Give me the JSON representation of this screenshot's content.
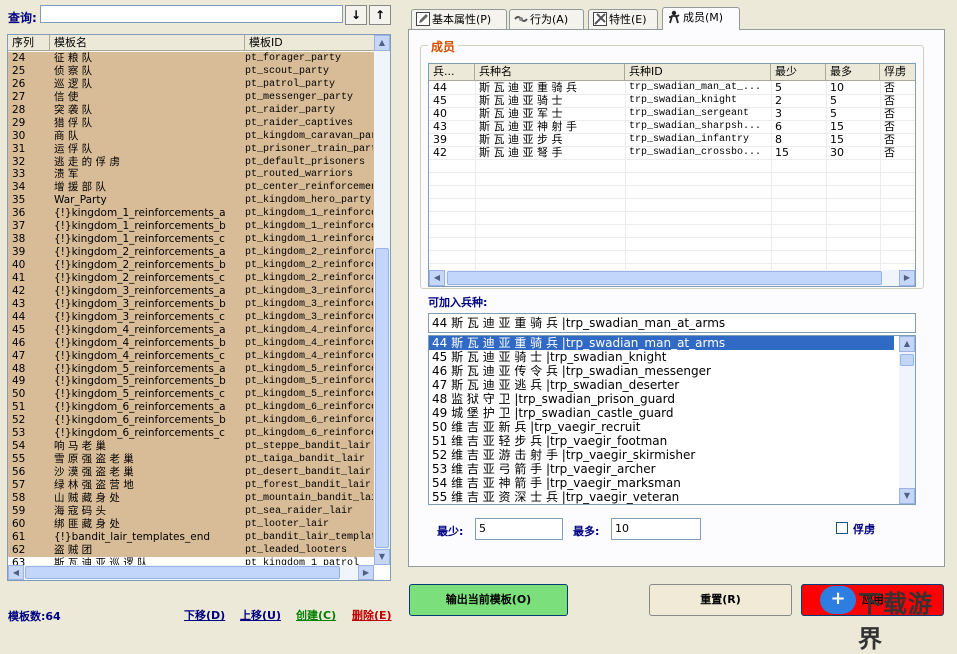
{
  "search": {
    "label": "查询:",
    "value": "",
    "down_label": "↓",
    "up_label": "↑"
  },
  "template_list": {
    "columns": [
      "序列",
      "模板名",
      "模板ID"
    ],
    "rows": [
      {
        "seq": "24",
        "name": "征 粮 队",
        "id": "pt_forager_party"
      },
      {
        "seq": "25",
        "name": "侦 察 队",
        "id": "pt_scout_party"
      },
      {
        "seq": "26",
        "name": "巡 逻 队",
        "id": "pt_patrol_party"
      },
      {
        "seq": "27",
        "name": "信 使",
        "id": "pt_messenger_party"
      },
      {
        "seq": "28",
        "name": "突 袭 队",
        "id": "pt_raider_party"
      },
      {
        "seq": "29",
        "name": "猎 俘 队",
        "id": "pt_raider_captives"
      },
      {
        "seq": "30",
        "name": "商 队",
        "id": "pt_kingdom_caravan_party"
      },
      {
        "seq": "31",
        "name": "运 俘 队",
        "id": "pt_prisoner_train_party"
      },
      {
        "seq": "32",
        "name": "逃 走 的 俘 虏",
        "id": "pt_default_prisoners"
      },
      {
        "seq": "33",
        "name": "溃 军",
        "id": "pt_routed_warriors"
      },
      {
        "seq": "34",
        "name": "增 援 部 队",
        "id": "pt_center_reinforcements"
      },
      {
        "seq": "35",
        "name": "War_Party",
        "id": "pt_kingdom_hero_party"
      },
      {
        "seq": "36",
        "name": "{!}kingdom_1_reinforcements_a",
        "id": "pt_kingdom_1_reinforcements_a"
      },
      {
        "seq": "37",
        "name": "{!}kingdom_1_reinforcements_b",
        "id": "pt_kingdom_1_reinforcements_b"
      },
      {
        "seq": "38",
        "name": "{!}kingdom_1_reinforcements_c",
        "id": "pt_kingdom_1_reinforcements_c"
      },
      {
        "seq": "39",
        "name": "{!}kingdom_2_reinforcements_a",
        "id": "pt_kingdom_2_reinforcements_a"
      },
      {
        "seq": "40",
        "name": "{!}kingdom_2_reinforcements_b",
        "id": "pt_kingdom_2_reinforcements_b"
      },
      {
        "seq": "41",
        "name": "{!}kingdom_2_reinforcements_c",
        "id": "pt_kingdom_2_reinforcements_c"
      },
      {
        "seq": "42",
        "name": "{!}kingdom_3_reinforcements_a",
        "id": "pt_kingdom_3_reinforcements_a"
      },
      {
        "seq": "43",
        "name": "{!}kingdom_3_reinforcements_b",
        "id": "pt_kingdom_3_reinforcements_b"
      },
      {
        "seq": "44",
        "name": "{!}kingdom_3_reinforcements_c",
        "id": "pt_kingdom_3_reinforcements_c"
      },
      {
        "seq": "45",
        "name": "{!}kingdom_4_reinforcements_a",
        "id": "pt_kingdom_4_reinforcements_a"
      },
      {
        "seq": "46",
        "name": "{!}kingdom_4_reinforcements_b",
        "id": "pt_kingdom_4_reinforcements_b"
      },
      {
        "seq": "47",
        "name": "{!}kingdom_4_reinforcements_c",
        "id": "pt_kingdom_4_reinforcements_c"
      },
      {
        "seq": "48",
        "name": "{!}kingdom_5_reinforcements_a",
        "id": "pt_kingdom_5_reinforcements_a"
      },
      {
        "seq": "49",
        "name": "{!}kingdom_5_reinforcements_b",
        "id": "pt_kingdom_5_reinforcements_b"
      },
      {
        "seq": "50",
        "name": "{!}kingdom_5_reinforcements_c",
        "id": "pt_kingdom_5_reinforcements_c"
      },
      {
        "seq": "51",
        "name": "{!}kingdom_6_reinforcements_a",
        "id": "pt_kingdom_6_reinforcements_a"
      },
      {
        "seq": "52",
        "name": "{!}kingdom_6_reinforcements_b",
        "id": "pt_kingdom_6_reinforcements_b"
      },
      {
        "seq": "53",
        "name": "{!}kingdom_6_reinforcements_c",
        "id": "pt_kingdom_6_reinforcements_c"
      },
      {
        "seq": "54",
        "name": "响 马 老 巢",
        "id": "pt_steppe_bandit_lair"
      },
      {
        "seq": "55",
        "name": "雪 原 强 盗 老 巢",
        "id": "pt_taiga_bandit_lair"
      },
      {
        "seq": "56",
        "name": "沙 漠 强 盗 老 巢",
        "id": "pt_desert_bandit_lair"
      },
      {
        "seq": "57",
        "name": "绿 林 强 盗 营 地",
        "id": "pt_forest_bandit_lair"
      },
      {
        "seq": "58",
        "name": "山 贼 藏 身 处",
        "id": "pt_mountain_bandit_lair"
      },
      {
        "seq": "59",
        "name": "海 寇 码 头",
        "id": "pt_sea_raider_lair"
      },
      {
        "seq": "60",
        "name": "绑 匪 藏 身 处",
        "id": "pt_looter_lair"
      },
      {
        "seq": "61",
        "name": "{!}bandit_lair_templates_end",
        "id": "pt_bandit_lair_templates_end"
      },
      {
        "seq": "62",
        "name": "盗 贼 团",
        "id": "pt_leaded_looters"
      },
      {
        "seq": "63",
        "name": "斯 瓦 迪 亚 巡 逻 队",
        "id": "pt_kingdom_1_patrol"
      }
    ]
  },
  "footer": {
    "count_label": "模板数:64",
    "move_down": "下移(D)",
    "move_up": "上移(U)",
    "create": "创建(C)",
    "delete": "删除(E)"
  },
  "tabs": [
    {
      "label": "基本属性(P)",
      "icon": "pencil-icon"
    },
    {
      "label": "行为(A)",
      "icon": "handshake-icon"
    },
    {
      "label": "特性(E)",
      "icon": "tools-icon"
    },
    {
      "label": "成员(M)",
      "icon": "person-icon"
    }
  ],
  "members": {
    "group_title": "成员",
    "columns": [
      "兵...",
      "兵种名",
      "兵种ID",
      "最少",
      "最多",
      "俘虏"
    ],
    "rows": [
      {
        "num": "44",
        "name": "斯 瓦 迪 亚 重 骑 兵",
        "id": "trp_swadian_man_at_...",
        "min": "5",
        "max": "10",
        "prisoner": "否"
      },
      {
        "num": "45",
        "name": "斯 瓦 迪 亚 骑 士",
        "id": "trp_swadian_knight",
        "min": "2",
        "max": "5",
        "prisoner": "否"
      },
      {
        "num": "40",
        "name": "斯 瓦 迪 亚 军 士",
        "id": "trp_swadian_sergeant",
        "min": "3",
        "max": "5",
        "prisoner": "否"
      },
      {
        "num": "43",
        "name": "斯 瓦 迪 亚 神 射 手",
        "id": "trp_swadian_sharpsh...",
        "min": "6",
        "max": "15",
        "prisoner": "否"
      },
      {
        "num": "39",
        "name": "斯 瓦 迪 亚 步 兵",
        "id": "trp_swadian_infantry",
        "min": "8",
        "max": "15",
        "prisoner": "否"
      },
      {
        "num": "42",
        "name": "斯 瓦 迪 亚 弩 手",
        "id": "trp_swadian_crossbo...",
        "min": "15",
        "max": "30",
        "prisoner": "否"
      }
    ]
  },
  "recruit": {
    "label": "可加入兵种:",
    "selected_value": "44 斯 瓦 迪 亚 重 骑 兵 |trp_swadian_man_at_arms",
    "options": [
      "44 斯 瓦 迪 亚 重 骑 兵 |trp_swadian_man_at_arms",
      "45 斯 瓦 迪 亚 骑 士 |trp_swadian_knight",
      "46 斯 瓦 迪 亚 传 令 兵 |trp_swadian_messenger",
      "47 斯 瓦 迪 亚 逃 兵 |trp_swadian_deserter",
      "48 监 狱 守 卫 |trp_swadian_prison_guard",
      "49 城 堡 护 卫 |trp_swadian_castle_guard",
      "50 维 吉 亚 新 兵 |trp_vaegir_recruit",
      "51 维 吉 亚 轻 步 兵 |trp_vaegir_footman",
      "52 维 吉 亚 游 击 射 手 |trp_vaegir_skirmisher",
      "53 维 吉 亚 弓 箭 手 |trp_vaegir_archer",
      "54 维 吉 亚 神 箭 手 |trp_vaegir_marksman",
      "55 维 吉 亚 资 深 士 兵 |trp_vaegir_veteran"
    ]
  },
  "fields": {
    "min_label": "最少:",
    "min_value": "5",
    "max_label": "最多:",
    "max_value": "10",
    "prisoner_label": "俘虏",
    "prisoner_checked": false
  },
  "buttons": {
    "export": "输出当前模板(O)",
    "reset": "重置(R)",
    "apply": "应用"
  },
  "watermark": {
    "text": "下载游界"
  },
  "colors": {
    "list_bg": "#d8bc98",
    "export_btn": "#7be07b",
    "apply_btn": "#ff0000",
    "accent_orange": "#d54f00",
    "selection": "#316ac5"
  }
}
